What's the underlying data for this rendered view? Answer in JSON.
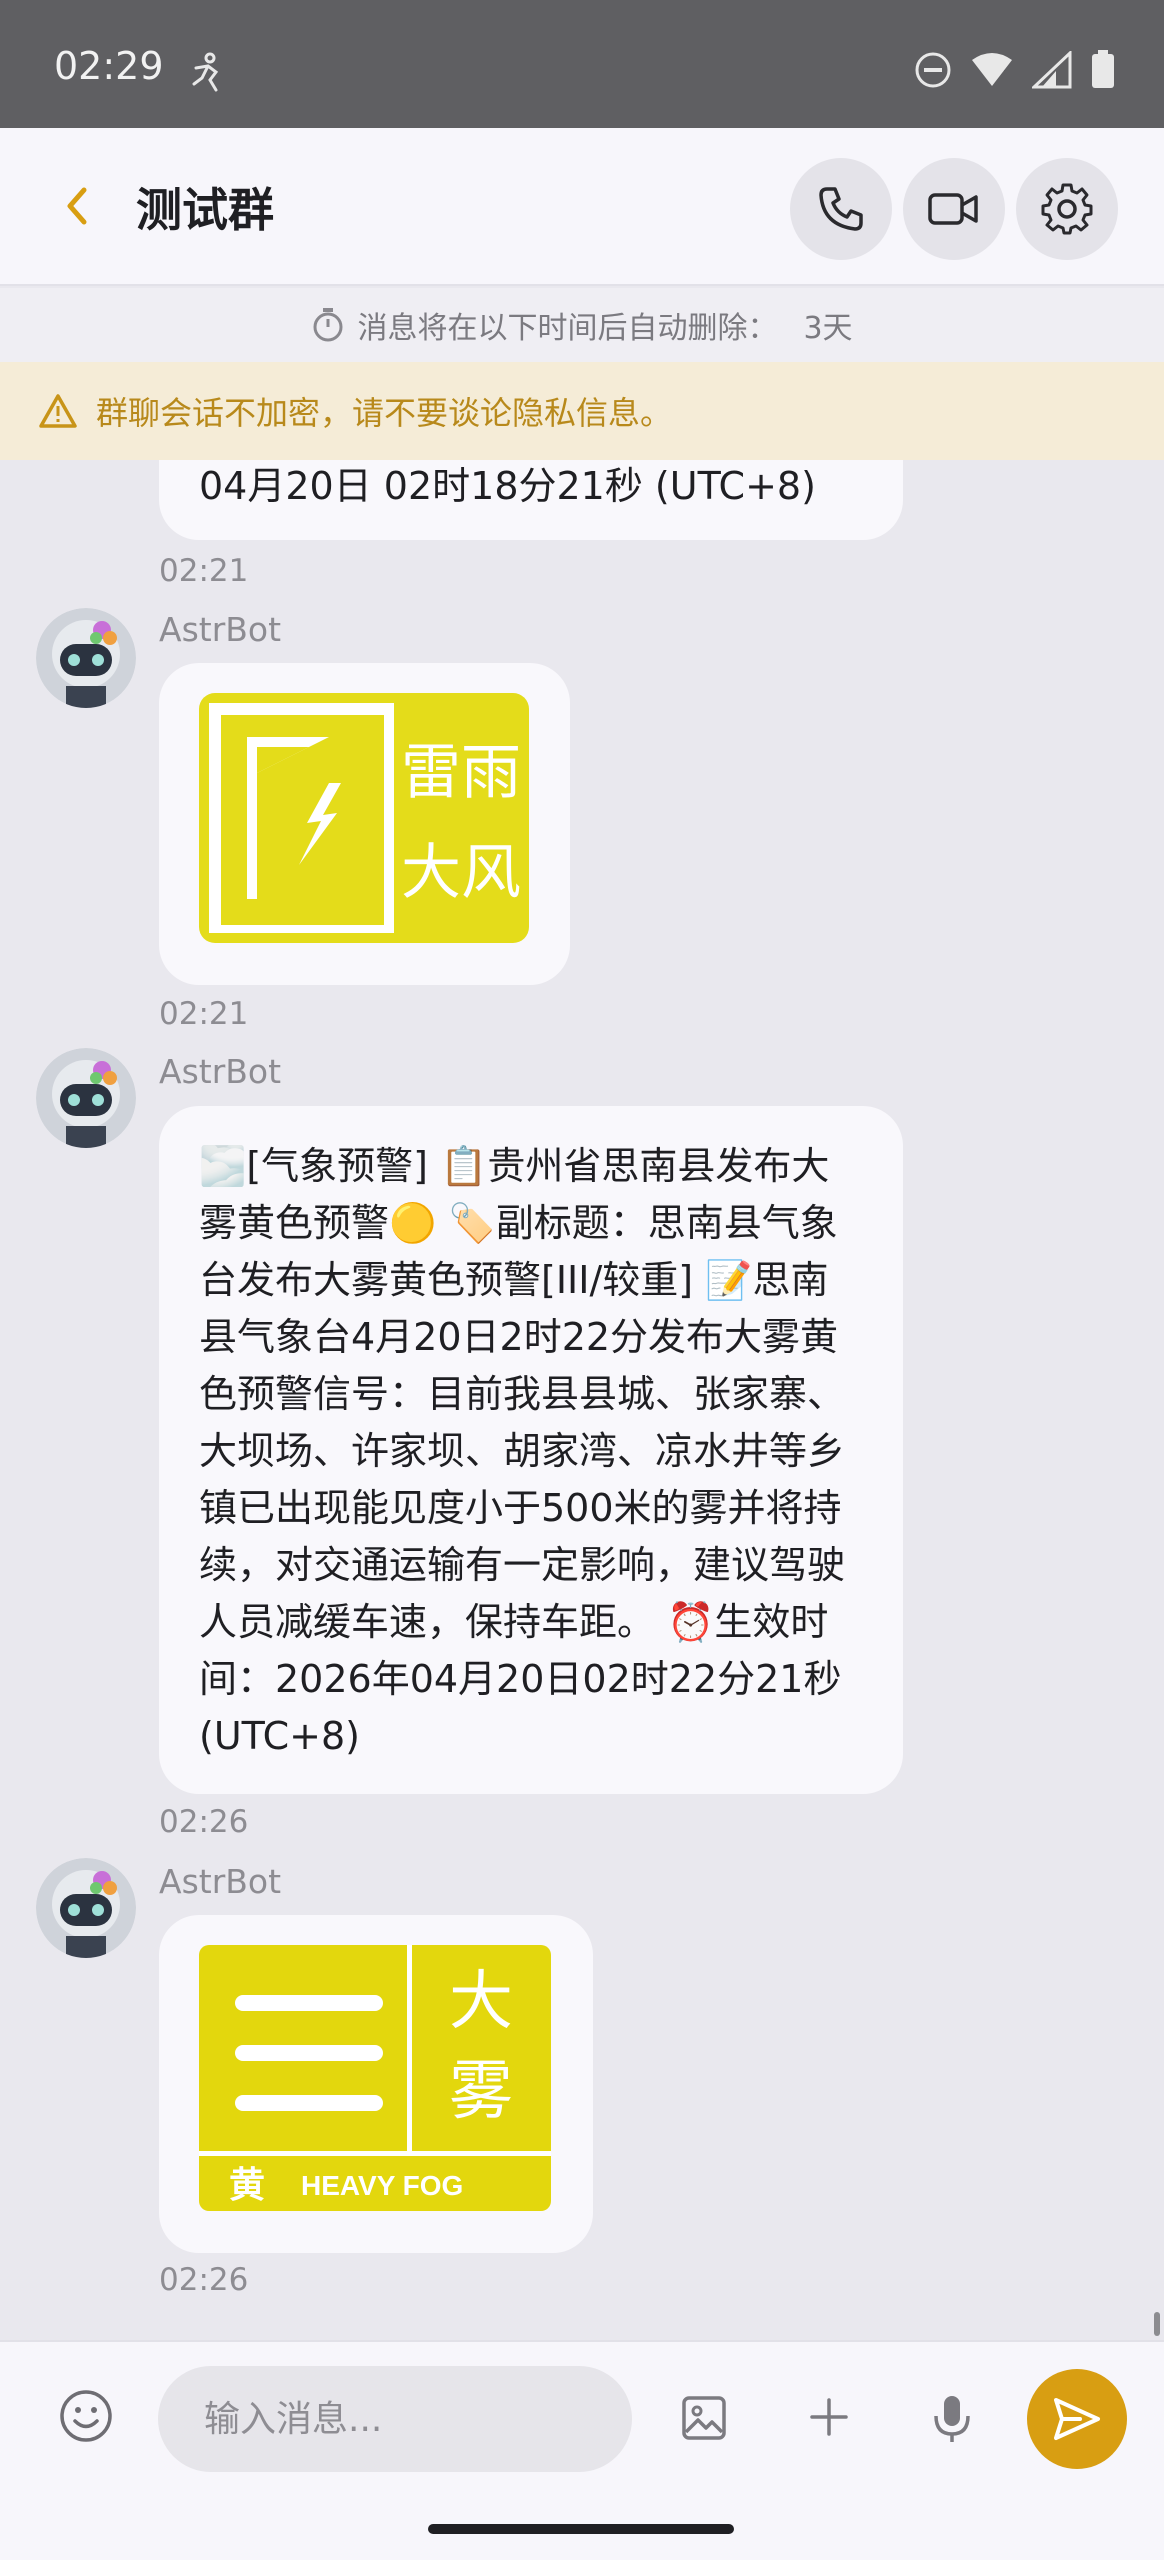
{
  "status_bar": {
    "time": "02:29"
  },
  "header": {
    "back_icon": "chevron-left-icon",
    "title": "测试群",
    "actions": [
      "phone-icon",
      "video-icon",
      "gear-icon"
    ]
  },
  "expire_notice": {
    "label": "消息将在以下时间后自动删除：",
    "value": "3天"
  },
  "warning": {
    "text": "群聊会话不加密，请不要谈论隐私信息。"
  },
  "messages": [
    {
      "type": "text-partial",
      "text": "04月20日 02时18分21秒 (UTC+8)",
      "time": "02:21"
    },
    {
      "type": "image",
      "sender": "AstrBot",
      "image_desc": "雷雨大风 warning icon",
      "image_text": [
        "雷雨",
        "大风"
      ],
      "color": "#e4dc1a",
      "time": "02:21"
    },
    {
      "type": "text",
      "sender": "AstrBot",
      "text": "🌫️[气象预警] 📋贵州省思南县发布大雾黄色预警🟡 🏷️副标题：思南县气象台发布大雾黄色预警[III/较重] 📝思南县气象台4月20日2时22分发布大雾黄色预警信号：目前我县县城、张家寨、大坝场、许家坝、胡家湾、凉水井等乡镇已出现能见度小于500米的雾并将持续，对交通运输有一定影响，建议驾驶人员减缓车速，保持车距。 ⏰生效时间：2026年04月20日02时22分21秒 (UTC+8)",
      "time": "02:26"
    },
    {
      "type": "image",
      "sender": "AstrBot",
      "image_desc": "大雾黄色 warning icon",
      "image_text": [
        "大",
        "雾",
        "黄",
        "HEAVY FOG"
      ],
      "color": "#e3d70d",
      "time": "02:26"
    }
  ],
  "input": {
    "placeholder": "输入消息...",
    "icons": [
      "emoji-icon",
      "image-icon",
      "plus-icon",
      "microphone-icon",
      "send-icon"
    ]
  },
  "colors": {
    "accent": "#d89e12",
    "warning_bg": "#f5ecd7",
    "warning_text": "#b8891b"
  }
}
